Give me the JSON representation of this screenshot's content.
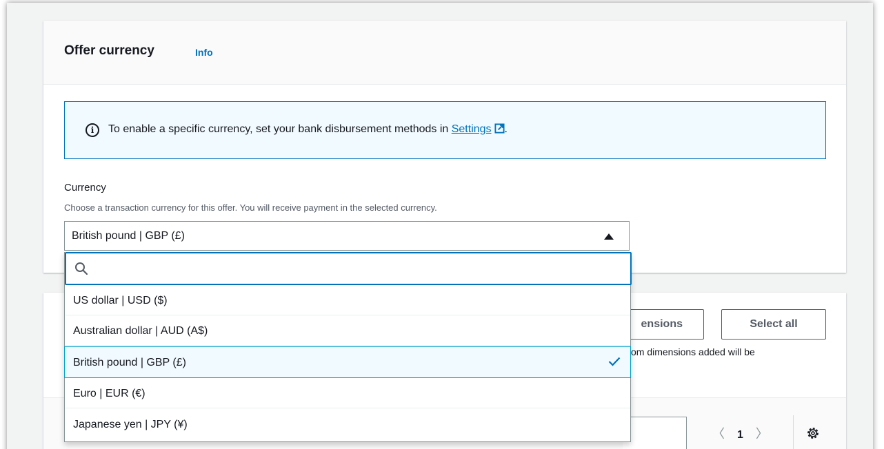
{
  "offer_currency": {
    "title": "Offer currency",
    "info_link": "Info",
    "alert": {
      "text_before": "To enable a specific currency, set your bank disbursement methods in ",
      "link": "Settings",
      "text_after": "."
    },
    "currency_label": "Currency",
    "currency_description": "Choose a transaction currency for this offer. You will receive payment in the selected currency.",
    "selected_value": "British pound | GBP (£)"
  },
  "dropdown": {
    "search_value": "",
    "options": [
      {
        "label": "US dollar | USD ($)",
        "selected": false
      },
      {
        "label": "Australian dollar | AUD (A$)",
        "selected": false
      },
      {
        "label": "British pound | GBP (£)",
        "selected": true
      },
      {
        "label": "Euro | EUR (€)",
        "selected": false
      },
      {
        "label": "Japanese yen | JPY (¥)",
        "selected": false
      }
    ]
  },
  "dimensions_section": {
    "dimensions_button": "ensions",
    "select_all_button": "Select all",
    "note": "om dimensions added will be",
    "pagination": {
      "prev": "〈",
      "page": "1",
      "next": "〉"
    }
  },
  "colors": {
    "link": "#0073bb",
    "alert_bg": "#f1faff",
    "selected_border": "#00a1c9",
    "page_bg": "#f2f3f3"
  },
  "icons": [
    "info-icon",
    "external-link-icon",
    "caret-up-icon",
    "search-icon",
    "check-icon",
    "gear-icon"
  ]
}
